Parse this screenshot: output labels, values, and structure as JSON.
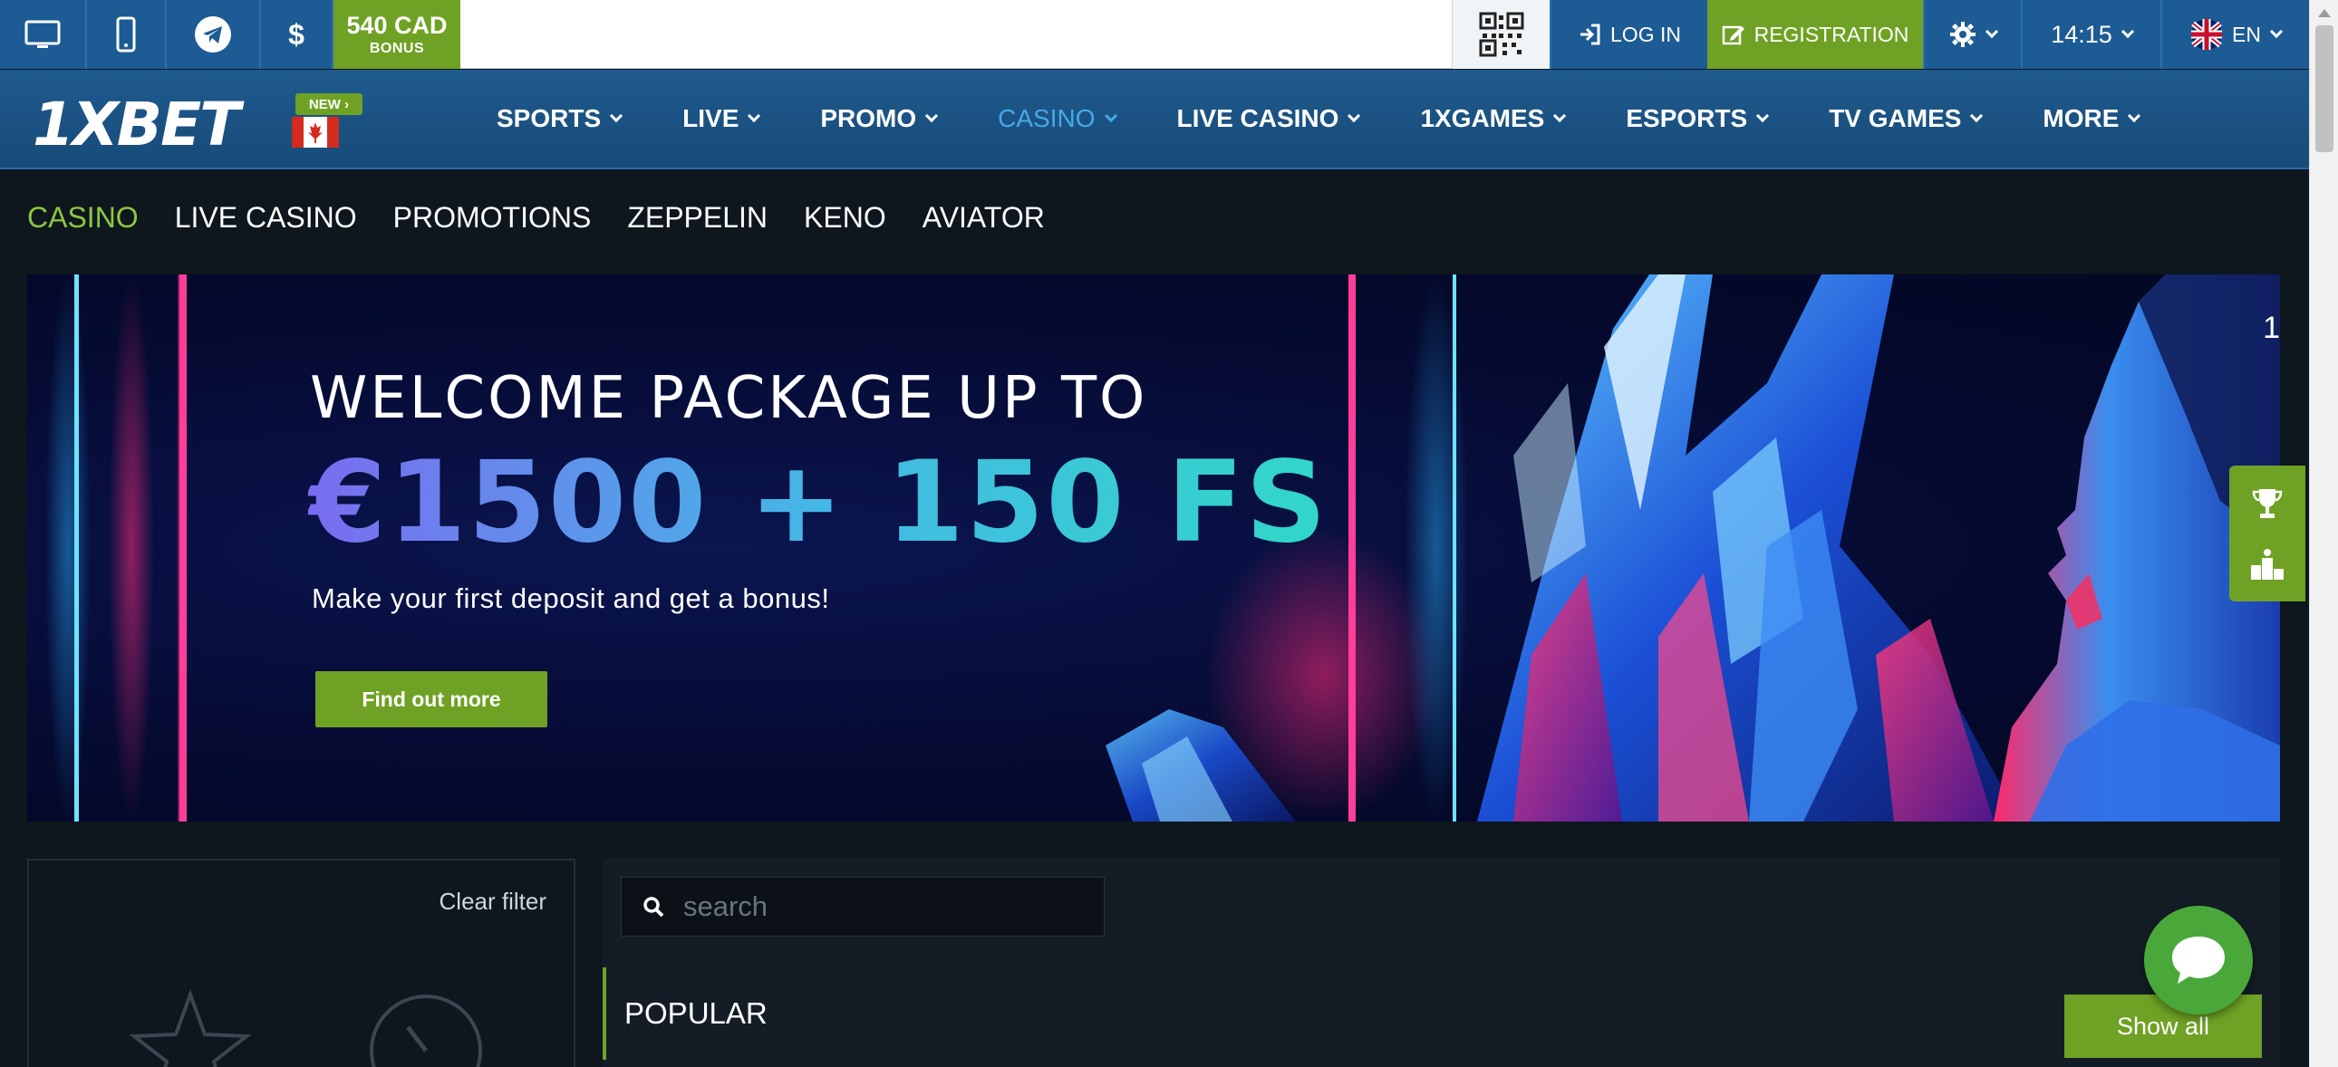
{
  "topbar": {
    "icons": [
      "desktop-icon",
      "mobile-icon",
      "telegram-icon",
      "dollar-icon"
    ],
    "bonus_amount": "540 CAD",
    "bonus_label": "BONUS",
    "login_label": "LOG IN",
    "registration_label": "REGISTRATION",
    "time": "14:15",
    "language": "EN"
  },
  "mainnav": {
    "logo": "1XBET",
    "new_badge": "NEW",
    "items": [
      {
        "label": "SPORTS"
      },
      {
        "label": "LIVE"
      },
      {
        "label": "PROMO"
      },
      {
        "label": "CASINO",
        "active": true
      },
      {
        "label": "LIVE CASINO"
      },
      {
        "label": "1XGAMES"
      },
      {
        "label": "ESPORTS"
      },
      {
        "label": "TV GAMES"
      },
      {
        "label": "MORE"
      }
    ]
  },
  "subnav": {
    "items": [
      {
        "label": "CASINO",
        "active": true
      },
      {
        "label": "LIVE CASINO"
      },
      {
        "label": "PROMOTIONS"
      },
      {
        "label": "ZEPPELIN"
      },
      {
        "label": "KENO"
      },
      {
        "label": "AVIATOR"
      }
    ]
  },
  "banner": {
    "title_line1": "WELCOME PACKAGE UP TO",
    "title_line2": "€1500 + 150 FS",
    "subtitle": "Make your first deposit and get a bonus!",
    "button": "Find out more",
    "slide_indicator": "1"
  },
  "filter": {
    "clear_label": "Clear filter"
  },
  "content": {
    "search_placeholder": "search",
    "section_title": "POPULAR",
    "show_all": "Show all"
  },
  "colors": {
    "brand_blue": "#1c5b93",
    "accent_green": "#6fa224",
    "active_link": "#47a8e8",
    "sub_active": "#8dc63f",
    "background": "#0e161e"
  }
}
